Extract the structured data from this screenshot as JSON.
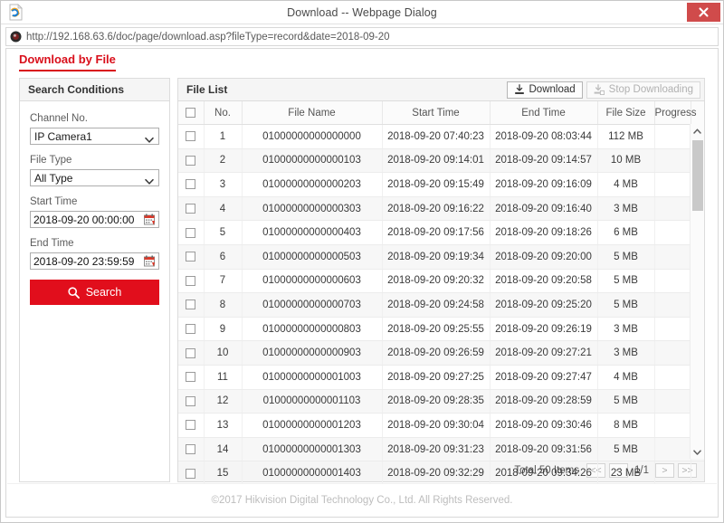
{
  "window": {
    "title": "Download -- Webpage Dialog",
    "close_label": "✕",
    "icon": "ie-page-icon"
  },
  "address": {
    "url": "http://192.168.63.6/doc/page/download.asp?fileType=record&date=2018-09-20",
    "icon": "globe-icon"
  },
  "tabs": [
    {
      "label": "Download by File",
      "active": true
    }
  ],
  "search_panel": {
    "header": "Search Conditions",
    "fields": [
      {
        "type": "select",
        "label": "Channel No.",
        "value": "IP Camera1",
        "name": "channel-no"
      },
      {
        "type": "select",
        "label": "File Type",
        "value": "All Type",
        "name": "file-type"
      },
      {
        "type": "date",
        "label": "Start Time",
        "value": "2018-09-20 00:00:00",
        "name": "start-time"
      },
      {
        "type": "date",
        "label": "End Time",
        "value": "2018-09-20 23:59:59",
        "name": "end-time"
      }
    ],
    "search_button": "Search"
  },
  "file_list": {
    "header": "File List",
    "download_button": "Download",
    "stop_button": "Stop Downloading",
    "columns": [
      "",
      "No.",
      "File Name",
      "Start Time",
      "End Time",
      "File Size",
      "Progress"
    ],
    "rows": [
      {
        "no": "1",
        "file_name": "01000000000000000",
        "start": "2018-09-20 07:40:23",
        "end": "2018-09-20 08:03:44",
        "size": "112 MB",
        "progress": ""
      },
      {
        "no": "2",
        "file_name": "01000000000000103",
        "start": "2018-09-20 09:14:01",
        "end": "2018-09-20 09:14:57",
        "size": "10 MB",
        "progress": ""
      },
      {
        "no": "3",
        "file_name": "01000000000000203",
        "start": "2018-09-20 09:15:49",
        "end": "2018-09-20 09:16:09",
        "size": "4 MB",
        "progress": ""
      },
      {
        "no": "4",
        "file_name": "01000000000000303",
        "start": "2018-09-20 09:16:22",
        "end": "2018-09-20 09:16:40",
        "size": "3 MB",
        "progress": ""
      },
      {
        "no": "5",
        "file_name": "01000000000000403",
        "start": "2018-09-20 09:17:56",
        "end": "2018-09-20 09:18:26",
        "size": "6 MB",
        "progress": ""
      },
      {
        "no": "6",
        "file_name": "01000000000000503",
        "start": "2018-09-20 09:19:34",
        "end": "2018-09-20 09:20:00",
        "size": "5 MB",
        "progress": ""
      },
      {
        "no": "7",
        "file_name": "01000000000000603",
        "start": "2018-09-20 09:20:32",
        "end": "2018-09-20 09:20:58",
        "size": "5 MB",
        "progress": ""
      },
      {
        "no": "8",
        "file_name": "01000000000000703",
        "start": "2018-09-20 09:24:58",
        "end": "2018-09-20 09:25:20",
        "size": "5 MB",
        "progress": ""
      },
      {
        "no": "9",
        "file_name": "01000000000000803",
        "start": "2018-09-20 09:25:55",
        "end": "2018-09-20 09:26:19",
        "size": "3 MB",
        "progress": ""
      },
      {
        "no": "10",
        "file_name": "01000000000000903",
        "start": "2018-09-20 09:26:59",
        "end": "2018-09-20 09:27:21",
        "size": "3 MB",
        "progress": ""
      },
      {
        "no": "11",
        "file_name": "01000000000001003",
        "start": "2018-09-20 09:27:25",
        "end": "2018-09-20 09:27:47",
        "size": "4 MB",
        "progress": ""
      },
      {
        "no": "12",
        "file_name": "01000000000001103",
        "start": "2018-09-20 09:28:35",
        "end": "2018-09-20 09:28:59",
        "size": "5 MB",
        "progress": ""
      },
      {
        "no": "13",
        "file_name": "01000000000001203",
        "start": "2018-09-20 09:30:04",
        "end": "2018-09-20 09:30:46",
        "size": "8 MB",
        "progress": ""
      },
      {
        "no": "14",
        "file_name": "01000000000001303",
        "start": "2018-09-20 09:31:23",
        "end": "2018-09-20 09:31:56",
        "size": "5 MB",
        "progress": ""
      },
      {
        "no": "15",
        "file_name": "01000000000001403",
        "start": "2018-09-20 09:32:29",
        "end": "2018-09-20 09:34:26",
        "size": "23 MB",
        "progress": ""
      }
    ]
  },
  "pagination": {
    "total": "Total 50 Items",
    "first": "<<",
    "prev": "<",
    "current": "1/1",
    "next": ">",
    "last": ">>"
  },
  "footer": {
    "copyright": "©2017 Hikvision Digital Technology Co., Ltd. All Rights Reserved."
  },
  "colors": {
    "brand_red": "#e10e1c",
    "close_red": "#d04b4b",
    "panel_gray": "#f5f5f5"
  }
}
